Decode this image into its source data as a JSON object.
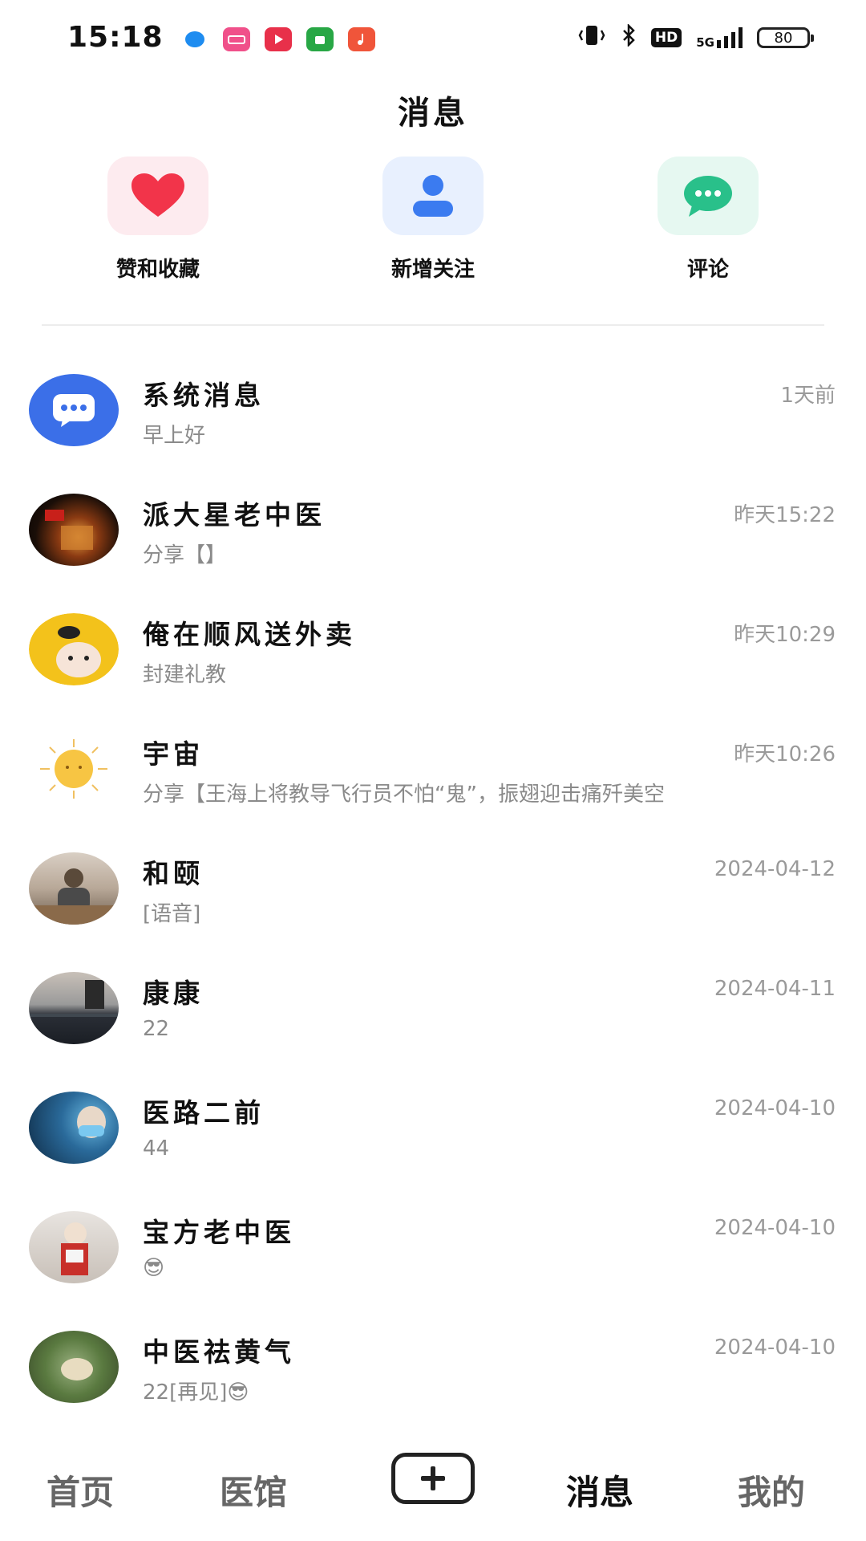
{
  "status_bar": {
    "time": "15:18",
    "network": "5G",
    "hd": "HD",
    "battery": "80"
  },
  "title": "消息",
  "quick_actions": [
    {
      "label": "赞和收藏",
      "icon": "heart-icon",
      "color": "#f2344a",
      "bg": "#fdebef"
    },
    {
      "label": "新增关注",
      "icon": "person-icon",
      "color": "#3b7bf0",
      "bg": "#e8f0fe"
    },
    {
      "label": "评论",
      "icon": "chat-bubble-icon",
      "color": "#29c08a",
      "bg": "#e6f8f1"
    }
  ],
  "messages": [
    {
      "name": "系统消息",
      "preview": "早上好",
      "time": "1天前"
    },
    {
      "name": "派大星老中医",
      "preview": "分享【】",
      "time": "昨天15:22"
    },
    {
      "name": "俺在顺风送外卖",
      "preview": "封建礼教",
      "time": "昨天10:29"
    },
    {
      "name": "宇宙",
      "preview": "分享【王海上将教导飞行员不怕“鬼”，振翅迎击痛歼美空",
      "time": "昨天10:26"
    },
    {
      "name": "和颐",
      "preview": "[语音]",
      "time": "2024-04-12"
    },
    {
      "name": "康康",
      "preview": "22",
      "time": "2024-04-11"
    },
    {
      "name": "医路二前",
      "preview": "44",
      "time": "2024-04-10"
    },
    {
      "name": "宝方老中医",
      "preview": "😎",
      "time": "2024-04-10"
    },
    {
      "name": "中医祛黄气",
      "preview": "22[再见]😎",
      "time": "2024-04-10"
    }
  ],
  "bottom_nav": {
    "home": "首页",
    "clinic": "医馆",
    "add": "+",
    "messages": "消息",
    "mine": "我的"
  }
}
